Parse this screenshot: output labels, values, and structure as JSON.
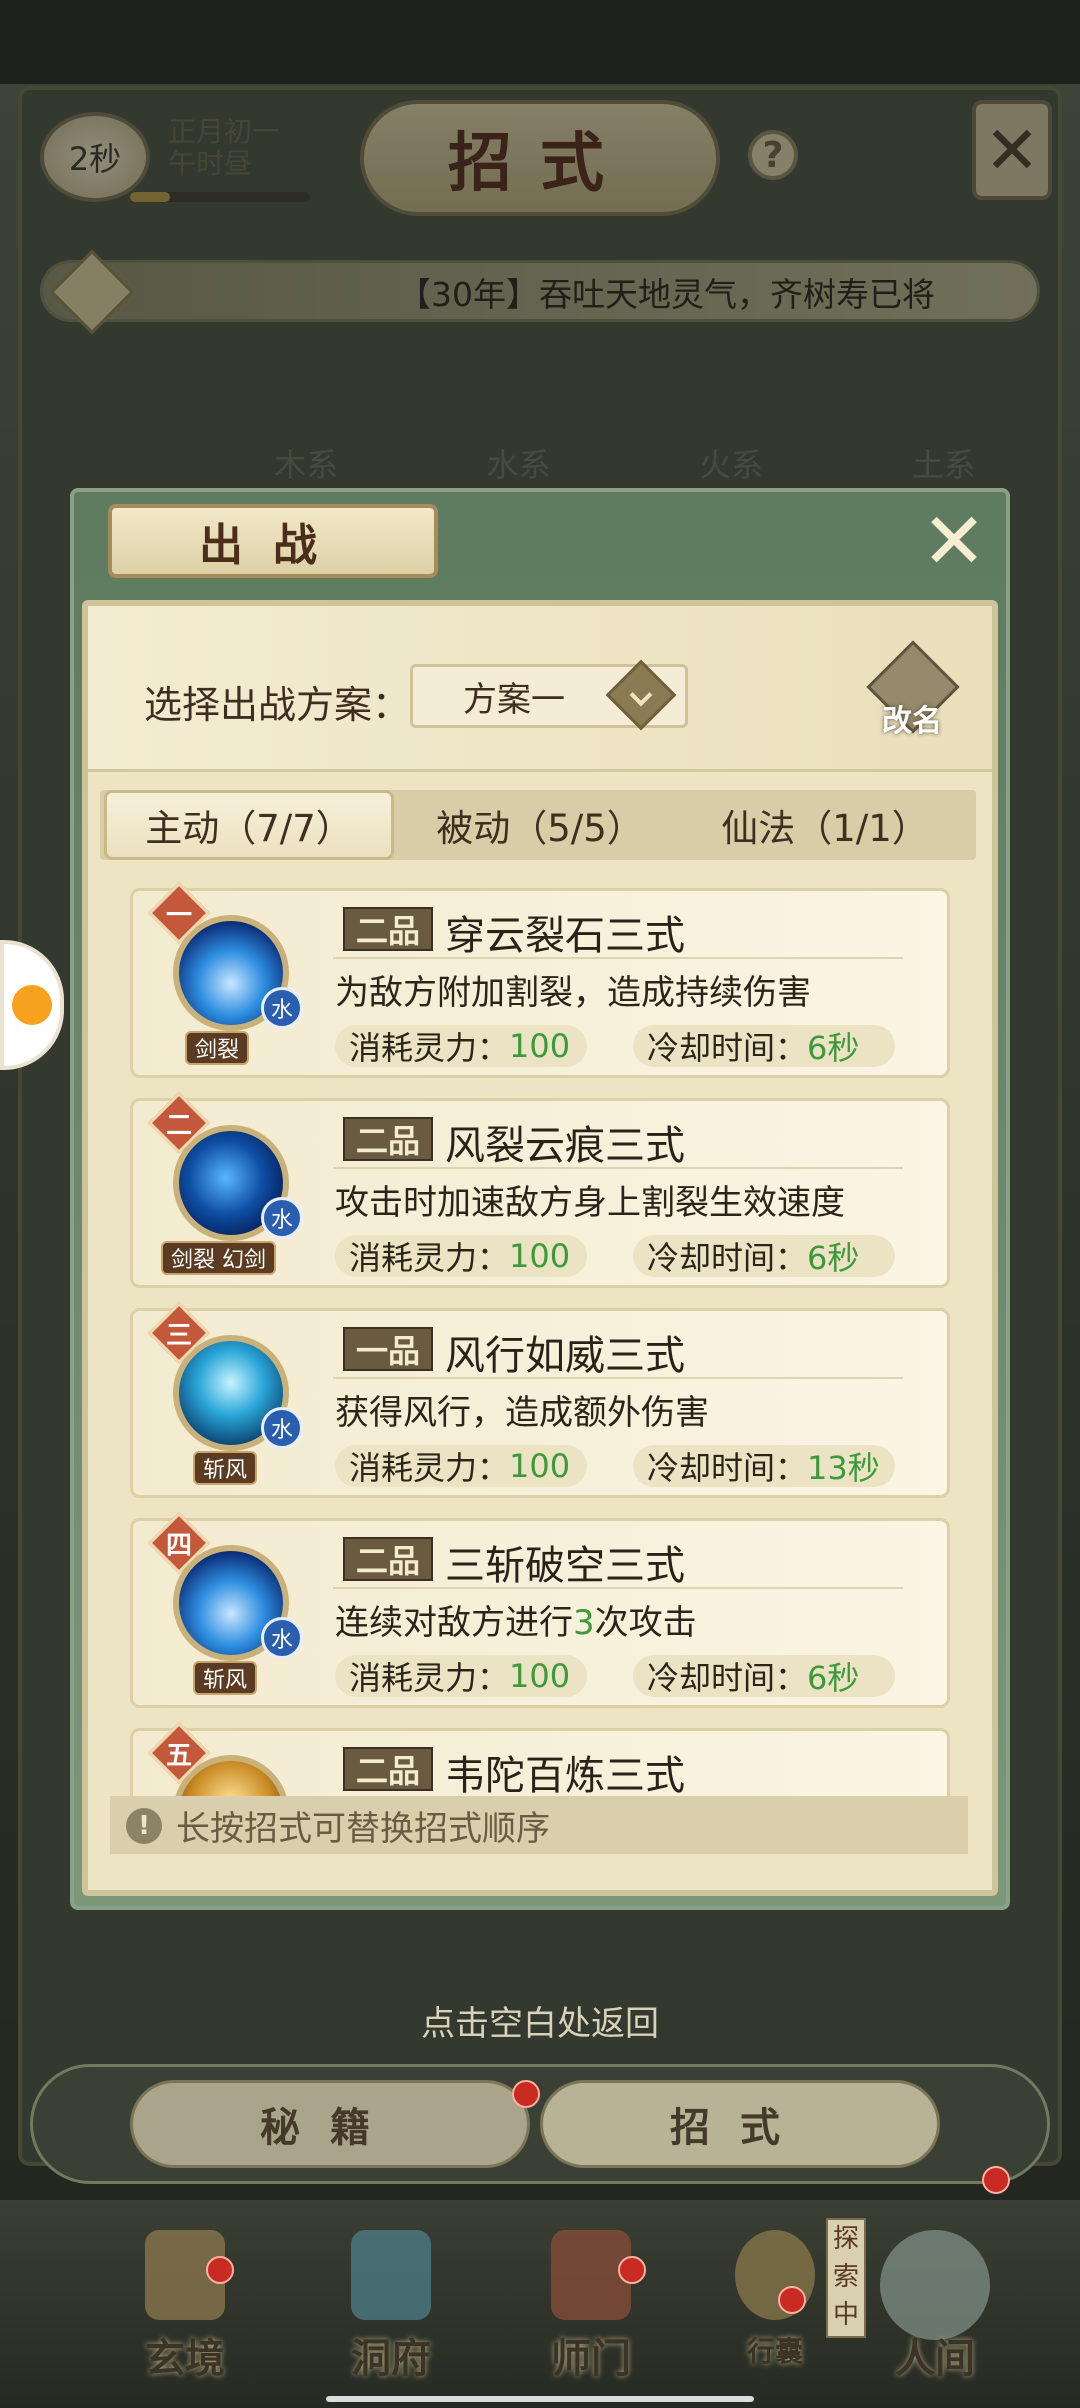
{
  "hud": {
    "timer": "2秒",
    "lunar_date": "正月初一",
    "lunar_time": "午时昼",
    "title": "招式",
    "help": "?",
    "ticker": "【30年】吞吐天地灵气，齐树寿已将"
  },
  "element_tabs": [
    "木系",
    "水系",
    "火系",
    "土系"
  ],
  "dialog": {
    "title": "出战",
    "plan_label": "选择出战方案：",
    "plan_value": "方案一",
    "rename": "改名",
    "tabs": [
      "主动（7/7）",
      "被动（5/5）",
      "仙法（1/1）"
    ],
    "cost_label": "消耗灵力：",
    "cd_label": "冷却时间：",
    "skills": [
      {
        "rank": "一",
        "grade": "二品",
        "name": "穿云裂石三式",
        "desc": "为敌方附加割裂，造成持续伤害",
        "cost": "100",
        "cooldown": "6秒",
        "element": "水",
        "tag": "剑裂"
      },
      {
        "rank": "二",
        "grade": "二品",
        "name": "风裂云痕三式",
        "desc": "攻击时加速敌方身上割裂生效速度",
        "cost": "100",
        "cooldown": "6秒",
        "element": "水",
        "tag": "剑裂 幻剑"
      },
      {
        "rank": "三",
        "grade": "一品",
        "name": "风行如威三式",
        "desc": "获得风行，造成额外伤害",
        "cost": "100",
        "cooldown": "13秒",
        "element": "水",
        "tag": "斩风"
      },
      {
        "rank": "四",
        "grade": "二品",
        "name": "三斩破空三式",
        "desc_pre": "连续对敌方进行",
        "desc_num": "3",
        "desc_post": "次攻击",
        "cost": "100",
        "cooldown": "6秒",
        "element": "水",
        "tag": "斩风"
      },
      {
        "rank": "五",
        "grade": "二品",
        "name": "韦陀百炼三式"
      }
    ],
    "tip": "长按招式可替换招式顺序"
  },
  "back_hint": "点击空白处返回",
  "bottom_tabs": [
    "秘籍",
    "招式"
  ],
  "nav": [
    "玄境",
    "洞府",
    "师门",
    "行囊",
    "人间"
  ],
  "explore_badge": "探索中",
  "colors": {
    "accent_green": "#3d9a3a",
    "rank_red": "#c4583a",
    "dialog_green": "#6d8a6b"
  }
}
